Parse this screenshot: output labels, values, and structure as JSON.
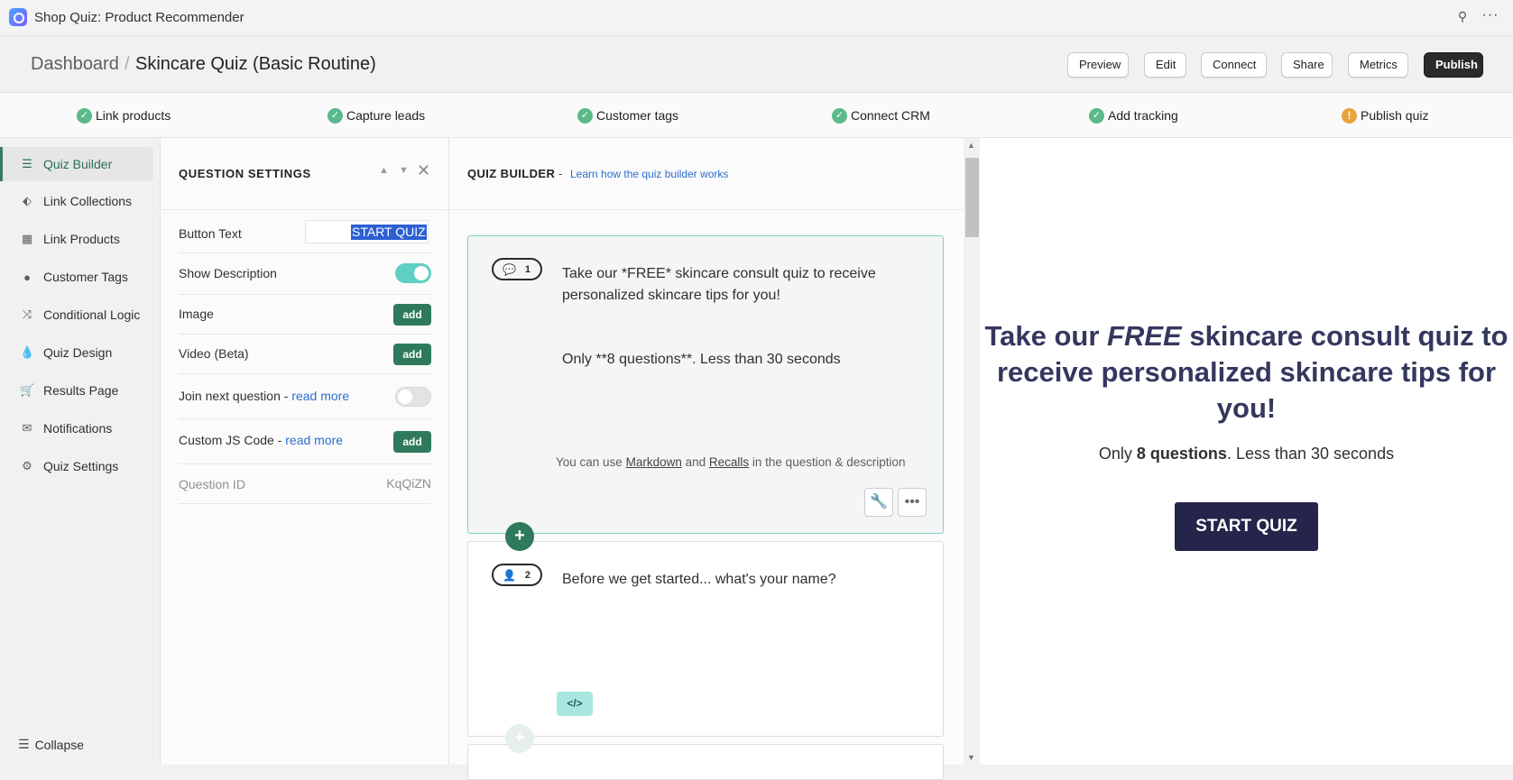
{
  "app": {
    "title": "Shop Quiz: Product Recommender",
    "pin_icon": "pin-icon",
    "more_icon": "more-icon"
  },
  "header": {
    "crumb_root": "Dashboard",
    "crumb_current": "Skincare Quiz (Basic Routine)",
    "buttons": {
      "preview": "Preview",
      "edit": "Edit",
      "connect": "Connect",
      "share": "Share",
      "metrics": "Metrics",
      "publish": "Publish"
    }
  },
  "steps": [
    {
      "label": "Link products",
      "status": "done"
    },
    {
      "label": "Capture leads",
      "status": "done"
    },
    {
      "label": "Customer tags",
      "status": "done"
    },
    {
      "label": "Connect CRM",
      "status": "done"
    },
    {
      "label": "Add tracking",
      "status": "done"
    },
    {
      "label": "Publish quiz",
      "status": "warning"
    }
  ],
  "sidebar": {
    "items": [
      {
        "label": "Quiz Builder",
        "icon": "list-icon"
      },
      {
        "label": "Link Collections",
        "icon": "tag-icon"
      },
      {
        "label": "Link Products",
        "icon": "box-icon"
      },
      {
        "label": "Customer Tags",
        "icon": "user-icon"
      },
      {
        "label": "Conditional Logic",
        "icon": "logic-icon"
      },
      {
        "label": "Quiz Design",
        "icon": "drop-icon"
      },
      {
        "label": "Results Page",
        "icon": "cart-icon"
      },
      {
        "label": "Notifications",
        "icon": "mail-icon"
      },
      {
        "label": "Quiz Settings",
        "icon": "gear-icon"
      }
    ],
    "collapse": "Collapse"
  },
  "question_settings": {
    "title": "QUESTION SETTINGS",
    "button_text_label": "Button Text",
    "button_text_value": "START QUIZ",
    "show_description": "Show Description",
    "image": "Image",
    "video": "Video (Beta)",
    "join_next": "Join next question - ",
    "read_more": "read more",
    "custom_js": "Custom JS Code - ",
    "add": "add",
    "question_id_label": "Question ID",
    "question_id_value": "KqQiZN"
  },
  "builder": {
    "title": "QUIZ BUILDER",
    "dash": "-",
    "learn_link": "Learn how the quiz builder works",
    "q1": {
      "number": "1",
      "text": "Take our *FREE* skincare consult quiz to receive personalized skincare tips for you!",
      "desc": "Only **8 questions**. Less than 30 seconds"
    },
    "hint_prefix": "You can use ",
    "hint_markdown": "Markdown",
    "hint_and": " and ",
    "hint_recalls": "Recalls",
    "hint_suffix": " in the question & description",
    "q2": {
      "number": "2",
      "text": "Before we get started... what's your name?"
    },
    "code_label": "</>"
  },
  "preview": {
    "title_pre": "Take our ",
    "title_em": "FREE",
    "title_post": " skincare consult quiz to receive personalized skincare tips for you!",
    "desc_pre": "Only ",
    "desc_bold": "8 questions",
    "desc_post": ". Less than 30 seconds",
    "button": "START QUIZ"
  }
}
